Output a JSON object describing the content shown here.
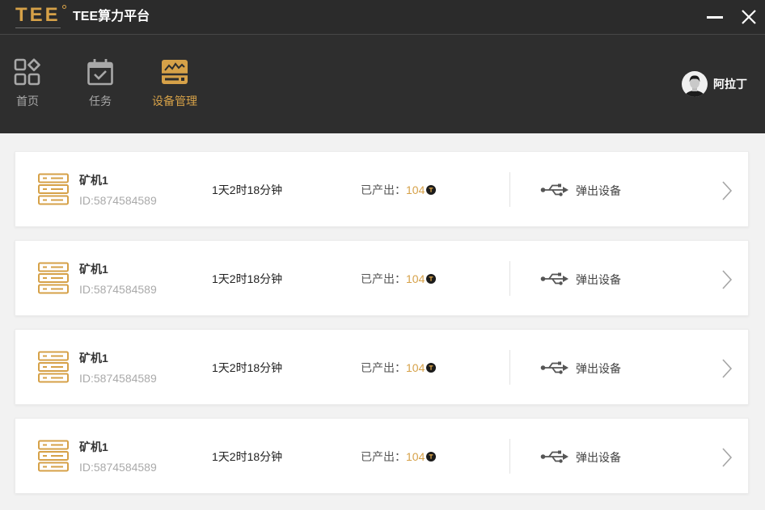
{
  "window": {
    "logo": "TEE",
    "title": "TEE算力平台",
    "minimize_icon": "minimize-icon",
    "close_icon": "close-icon"
  },
  "nav": {
    "items": [
      {
        "label": "首页",
        "icon": "grid-icon",
        "active": false
      },
      {
        "label": "任务",
        "icon": "calendar-check-icon",
        "active": false
      },
      {
        "label": "设备管理",
        "icon": "device-manage-icon",
        "active": true
      }
    ]
  },
  "user": {
    "name": "阿拉丁",
    "avatar_icon": "avatar"
  },
  "devices": [
    {
      "name": "矿机1",
      "id": "ID:5874584589",
      "uptime": "1天2时18分钟",
      "output_label": "已产出：",
      "output_value": "104",
      "action_label": "弹出设备"
    },
    {
      "name": "矿机1",
      "id": "ID:5874584589",
      "uptime": "1天2时18分钟",
      "output_label": "已产出：",
      "output_value": "104",
      "action_label": "弹出设备"
    },
    {
      "name": "矿机1",
      "id": "ID:5874584589",
      "uptime": "1天2时18分钟",
      "output_label": "已产出：",
      "output_value": "104",
      "action_label": "弹出设备"
    },
    {
      "name": "矿机1",
      "id": "ID:5874584589",
      "uptime": "1天2时18分钟",
      "output_label": "已产出：",
      "output_value": "104",
      "action_label": "弹出设备"
    }
  ],
  "device_icons": {
    "device": "server-icon",
    "output": "coin-icon",
    "action": "usb-icon",
    "open": "chevron-right-icon"
  },
  "colors": {
    "titlebar": "#2b2b2b",
    "nav": "#2e2e2e",
    "accent": "#d6a148",
    "muted": "#a8a8a8",
    "page": "#f2f2f2",
    "card": "#ffffff"
  }
}
